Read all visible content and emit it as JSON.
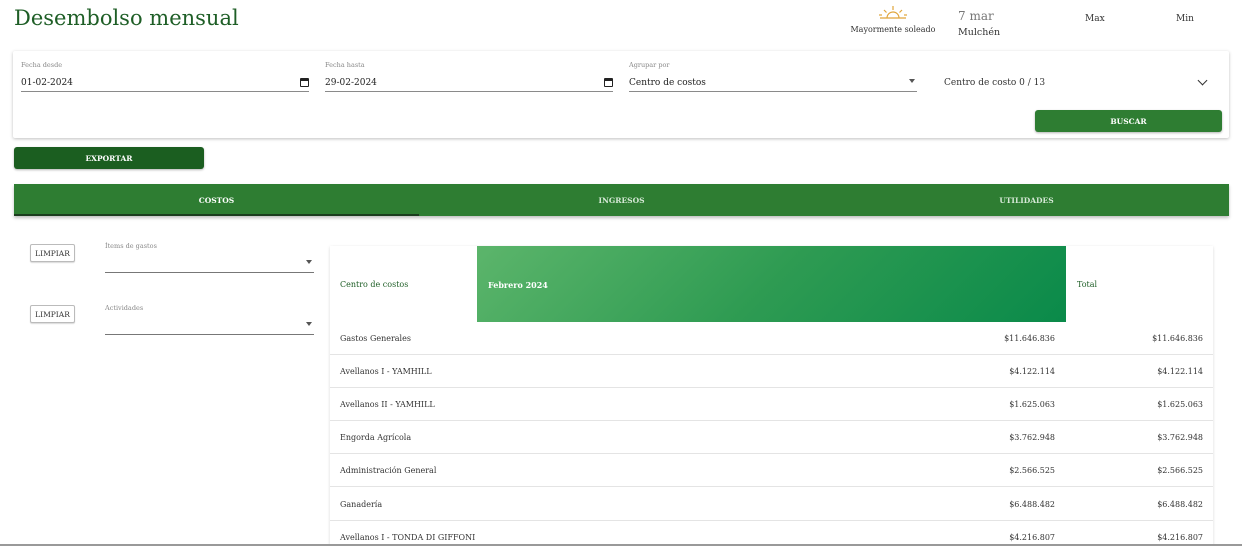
{
  "header": {
    "title": "Desembolso mensual",
    "weather": {
      "icon": "sun-horizon-icon",
      "description": "Mayormente soleado",
      "date": "7 mar",
      "city": "Mulchén",
      "max_label": "Max",
      "min_label": "Min"
    }
  },
  "filters": {
    "date_from": {
      "label": "Fecha desde",
      "value": "01-02-2024"
    },
    "date_to": {
      "label": "Fecha hasta",
      "value": "29-02-2024"
    },
    "group_by": {
      "label": "Agrupar por",
      "value": "Centro de costos"
    },
    "cost_center": {
      "label": "Centro de costo 0 / 13"
    },
    "search_label": "BUSCAR"
  },
  "export_label": "EXPORTAR",
  "tabs": [
    {
      "label": "COSTOS",
      "active": true
    },
    {
      "label": "INGRESOS",
      "active": false
    },
    {
      "label": "UTILIDADES",
      "active": false
    }
  ],
  "side_filters": [
    {
      "clear_label": "LIMPIAR",
      "label": "Ítems de gastos",
      "value": ""
    },
    {
      "clear_label": "LIMPIAR",
      "label": "Actividades",
      "value": ""
    }
  ],
  "table": {
    "headers": {
      "cost_center": "Centro de costos",
      "month": "Febrero 2024",
      "total": "Total"
    },
    "rows": [
      {
        "name": "Gastos Generales",
        "value": "$11.646.836",
        "total": "$11.646.836"
      },
      {
        "name": "Avellanos I - YAMHILL",
        "value": "$4.122.114",
        "total": "$4.122.114"
      },
      {
        "name": "Avellanos II - YAMHILL",
        "value": "$1.625.063",
        "total": "$1.625.063"
      },
      {
        "name": "Engorda Agrícola",
        "value": "$3.762.948",
        "total": "$3.762.948"
      },
      {
        "name": "Administración General",
        "value": "$2.566.525",
        "total": "$2.566.525"
      },
      {
        "name": "Ganadería",
        "value": "$6.488.482",
        "total": "$6.488.482"
      },
      {
        "name": "Avellanos I - TONDA DI GIFFONI",
        "value": "$4.216.807",
        "total": "$4.216.807"
      }
    ]
  },
  "colors": {
    "primary": "#2e7d32",
    "primary_dark": "#1b5e20",
    "title": "#1e5e26"
  }
}
